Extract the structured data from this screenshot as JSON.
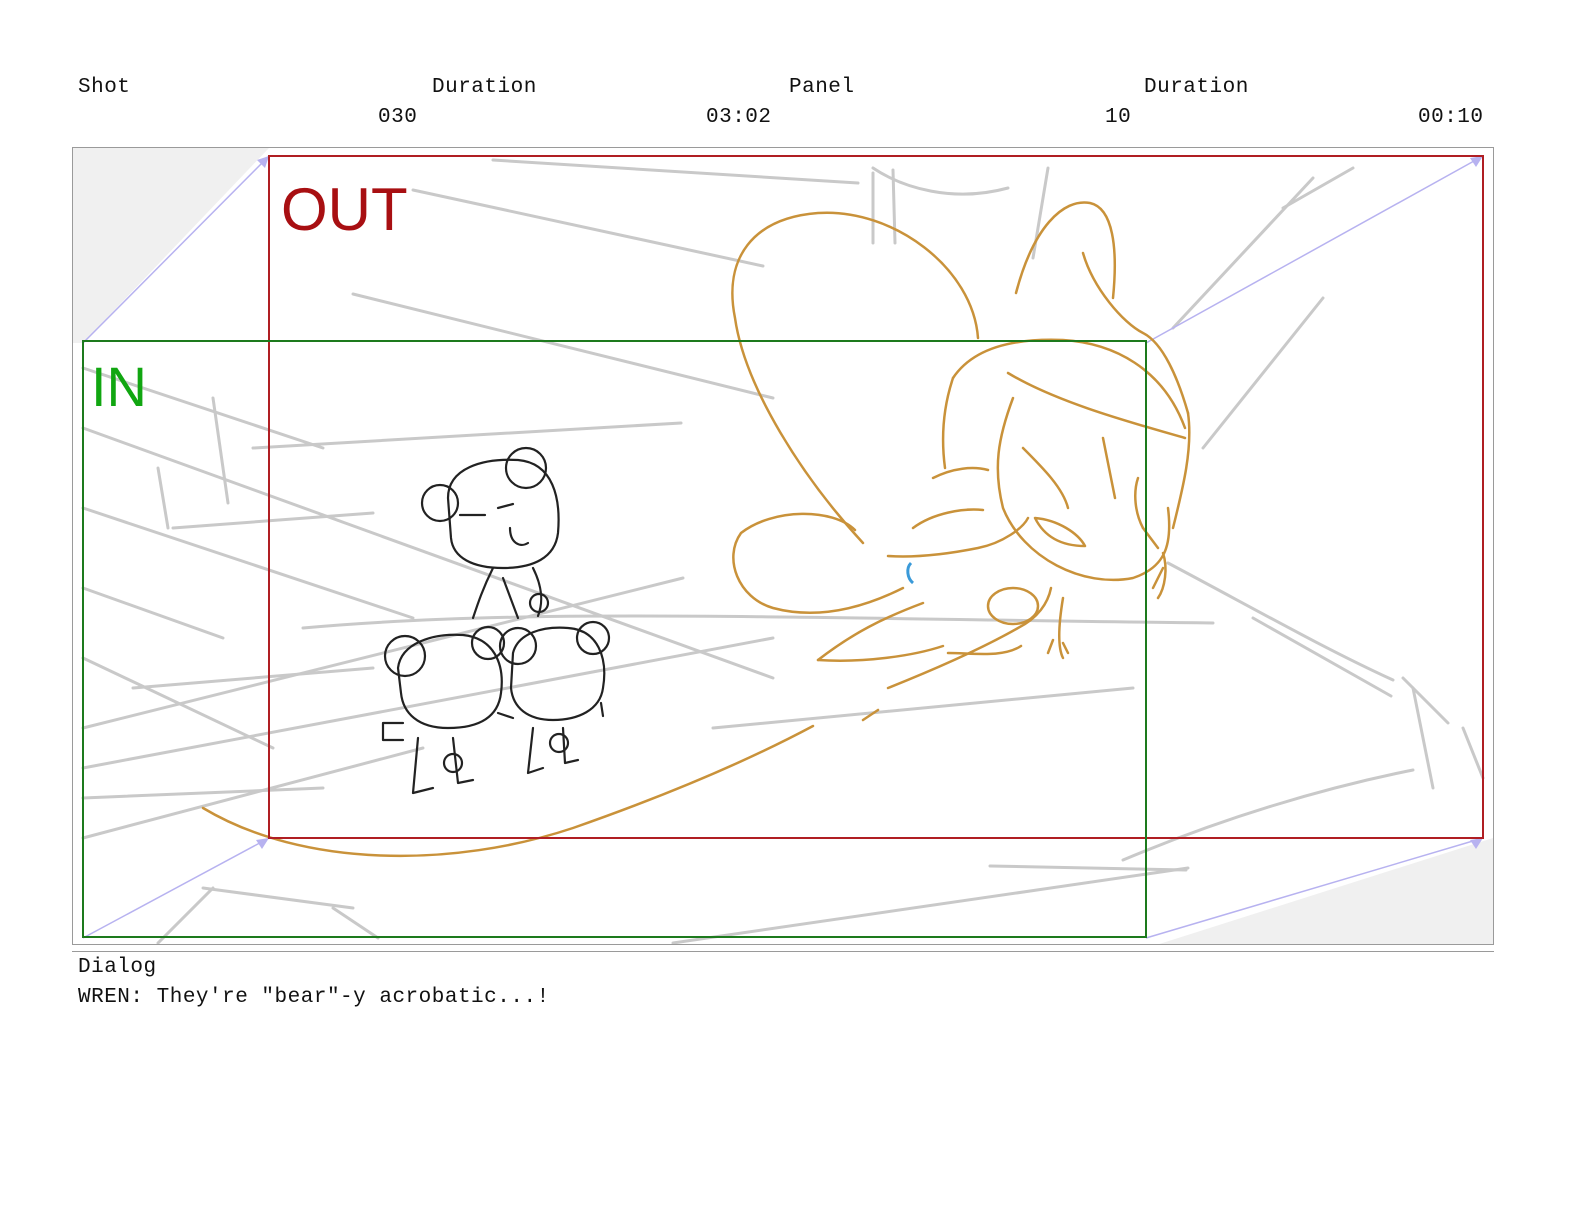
{
  "header": {
    "shot_label": "Shot",
    "duration_label_1": "Duration",
    "panel_label": "Panel",
    "duration_label_2": "Duration",
    "shot_value": "030",
    "shot_duration_value": "03:02",
    "panel_value": "10",
    "panel_duration_value": "00:10"
  },
  "frame": {
    "out_label": "OUT",
    "in_label": "IN",
    "colors": {
      "out_box": "#b01e23",
      "in_box": "#1d7a1d",
      "out_text": "#a80f12",
      "in_text": "#11a611",
      "camera_arrow": "#b7b2f0",
      "background_lines": "#c8c8c8",
      "bears": "#222222",
      "fairy": "#c9923a",
      "accent": "#3a9ad9"
    }
  },
  "dialog": {
    "label": "Dialog",
    "text": "WREN: They're \"bear\"-y acrobatic...!"
  }
}
